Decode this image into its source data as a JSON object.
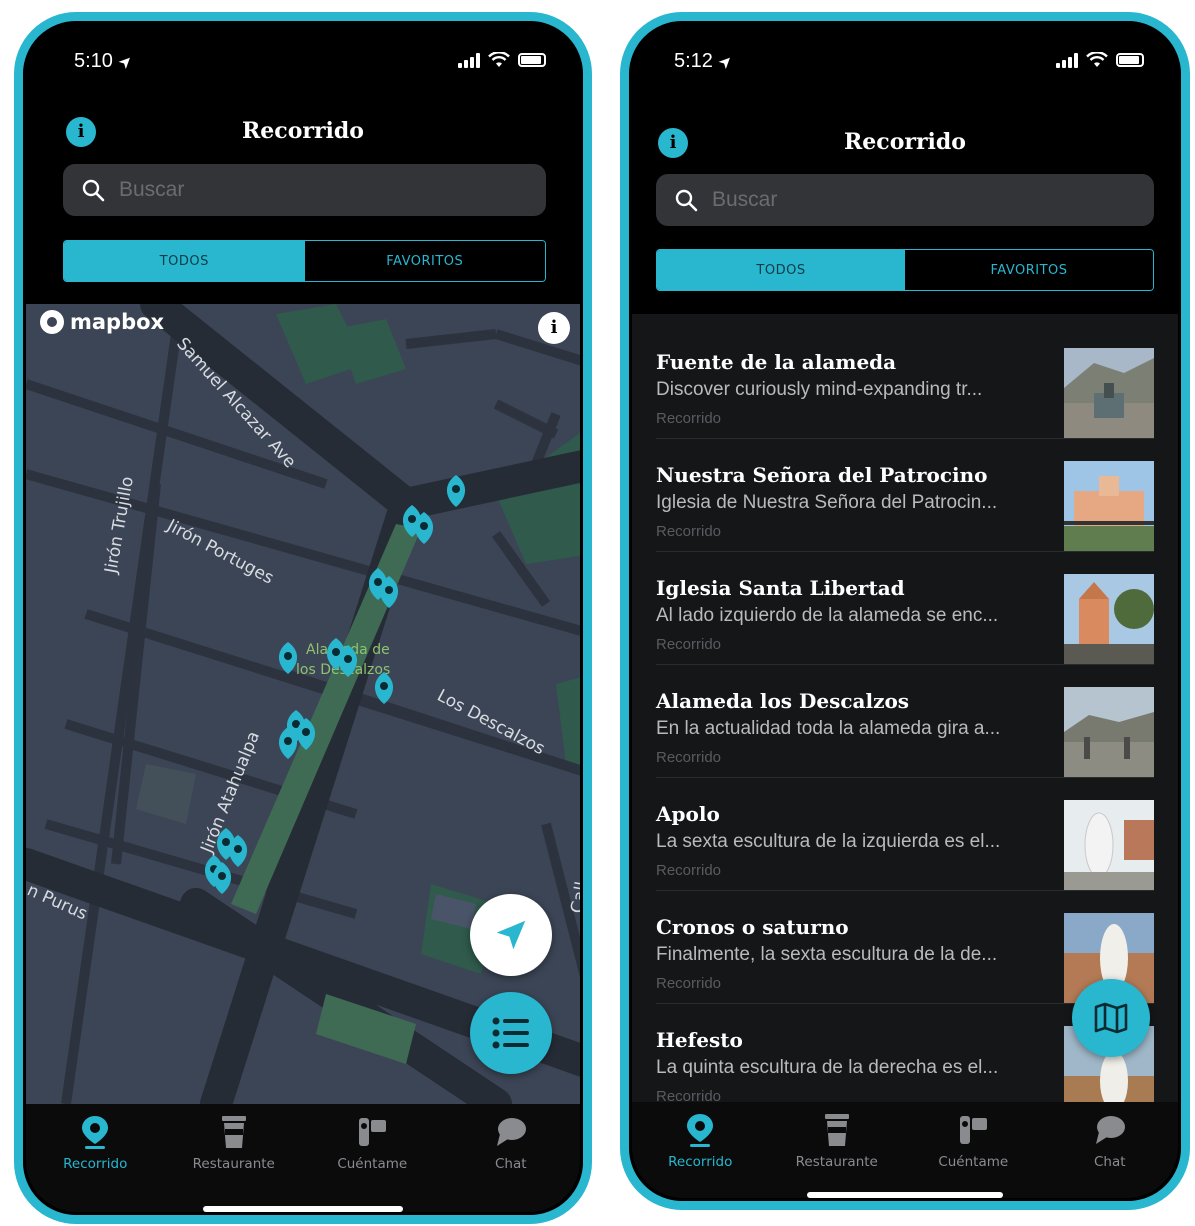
{
  "left": {
    "status": {
      "time": "5:10"
    },
    "header": {
      "title": "Recorrido"
    },
    "search": {
      "placeholder": "Buscar"
    },
    "segments": {
      "all": "TODOS",
      "favorites": "FAVORITOS"
    },
    "map": {
      "logo": "mapbox",
      "streets": {
        "samuel": "Samuel Alcazar Ave",
        "trujillo": "Jirón Trujillo",
        "portuges": "Jirón Portuges",
        "descalzos": "Los Descalzos",
        "atahualpa": "Jirón Atahualpa",
        "purus": "n Purus",
        "call": "Call"
      },
      "park_label_1": "Alameda de",
      "park_label_2": "los Descalzos"
    },
    "tabs": [
      {
        "label": "Recorrido"
      },
      {
        "label": "Restaurante"
      },
      {
        "label": "Cuéntame"
      },
      {
        "label": "Chat"
      }
    ]
  },
  "right": {
    "status": {
      "time": "5:12"
    },
    "header": {
      "title": "Recorrido"
    },
    "search": {
      "placeholder": "Buscar"
    },
    "segments": {
      "all": "TODOS",
      "favorites": "FAVORITOS"
    },
    "items": [
      {
        "name": "Fuente de la alameda",
        "desc": "Discover curiously mind-expanding tr...",
        "category": "Recorrido"
      },
      {
        "name": "Nuestra Señora del Patrocino",
        "desc": "Iglesia de Nuestra Señora del Patrocin...",
        "category": "Recorrido"
      },
      {
        "name": "Iglesia Santa Libertad",
        "desc": "Al lado izquierdo de la alameda se enc...",
        "category": "Recorrido"
      },
      {
        "name": "Alameda los Descalzos",
        "desc": "En la actualidad toda la alameda gira a...",
        "category": "Recorrido"
      },
      {
        "name": "Apolo",
        "desc": "La sexta escultura de la izquierda es el...",
        "category": "Recorrido"
      },
      {
        "name": "Cronos o saturno",
        "desc": "Finalmente, la sexta escultura de la de...",
        "category": "Recorrido"
      },
      {
        "name": "Hefesto",
        "desc": "La quinta escultura de la derecha es el...",
        "category": "Recorrido"
      }
    ],
    "tabs": [
      {
        "label": "Recorrido"
      },
      {
        "label": "Restaurante"
      },
      {
        "label": "Cuéntame"
      },
      {
        "label": "Chat"
      }
    ]
  },
  "colors": {
    "accent": "#29b6cf",
    "background": "#000000",
    "map": "#3c4555",
    "list": "#151618"
  }
}
